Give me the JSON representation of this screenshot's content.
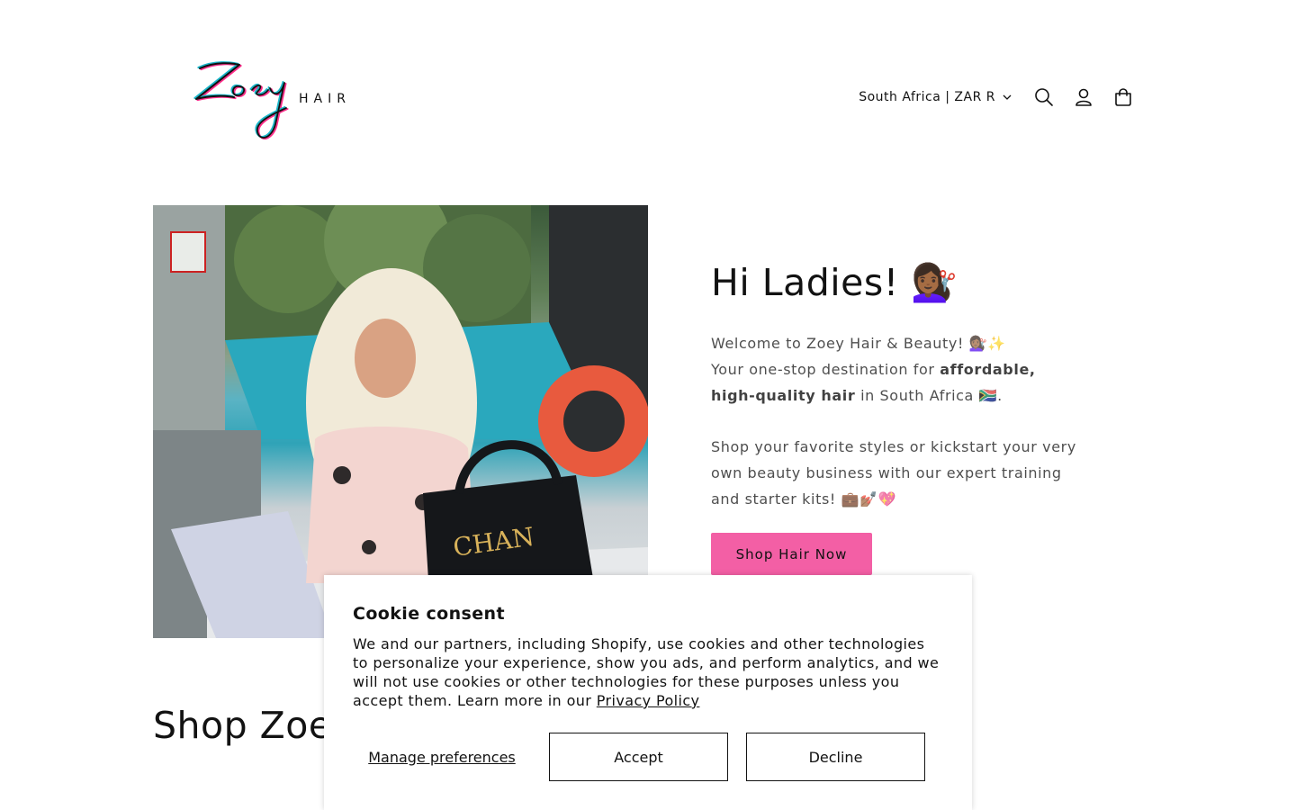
{
  "header": {
    "logo_text": "Zoey HAIR",
    "country_selector": "South Africa | ZAR R",
    "icons": [
      "search-icon",
      "account-icon",
      "cart-icon"
    ]
  },
  "hero": {
    "title": "Hi Ladies! 💇🏾‍♀️",
    "welcome_line": "Welcome to Zoey Hair & Beauty! 💇🏾‍♀️✨",
    "dest_prefix": "Your one-stop destination for ",
    "dest_bold": "affordable, high-quality hair",
    "dest_suffix": " in South Africa 🇿🇦.",
    "paragraph2": "Shop your favorite styles or kickstart your very own beauty business with our expert training and starter kits! 💼💅🏾💖",
    "cta_label": "Shop Hair Now",
    "image_alt": "Woman with long platinum blonde hair at poolside with laptop and handbag"
  },
  "section": {
    "title": "Shop Zoey"
  },
  "cookie": {
    "title": "Cookie consent",
    "body": "We and our partners, including Shopify, use cookies and other technologies to personalize your experience, show you ads, and perform analytics, and we will not use cookies or other technologies for these purposes unless you accept them. Learn more in our ",
    "privacy_link": "Privacy Policy",
    "manage_label": "Manage preferences",
    "accept_label": "Accept",
    "decline_label": "Decline"
  },
  "colors": {
    "cta": "#f35fa5",
    "text": "#121212"
  }
}
